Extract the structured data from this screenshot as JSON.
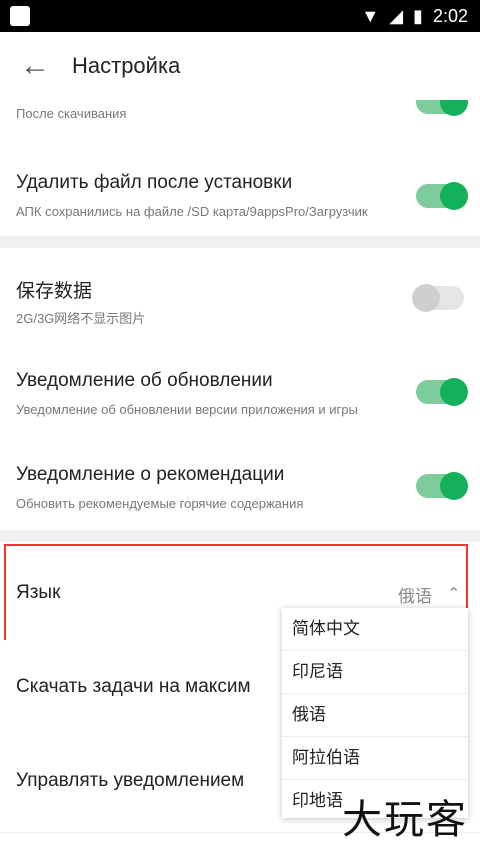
{
  "statusbar": {
    "time": "2:02"
  },
  "appbar": {
    "title": "Настройка"
  },
  "settings": {
    "after_download": {
      "subtitle": "После скачивания"
    },
    "delete_after_install": {
      "title": "Удалить файл после установки",
      "subtitle": "АПК сохранились на файле /SD карта/9appsPro/Загрузчик"
    },
    "save_data": {
      "title": "保存数据",
      "subtitle": "2G/3G网络不显示图片"
    },
    "update_notification": {
      "title": "Уведомление об обновлении",
      "subtitle": "Уведомление об обновлении версии приложения и игры"
    },
    "recommend_notification": {
      "title": "Уведомление о рекомендации",
      "subtitle": "Обновить рекомендуемые горячие содержания"
    },
    "language": {
      "title": "Язык",
      "value": "俄语"
    },
    "download_tasks": {
      "title": "Скачать задачи на максим"
    },
    "manage_notifications": {
      "title": "Управлять уведомлением"
    }
  },
  "language_options": [
    "简体中文",
    "印尼语",
    "俄语",
    "阿拉伯语",
    "印地语"
  ],
  "watermark": "大玩客",
  "colors": {
    "switch_on": "#13b15a",
    "switch_track_on": "#7ccc9c",
    "highlight": "#e33333"
  }
}
